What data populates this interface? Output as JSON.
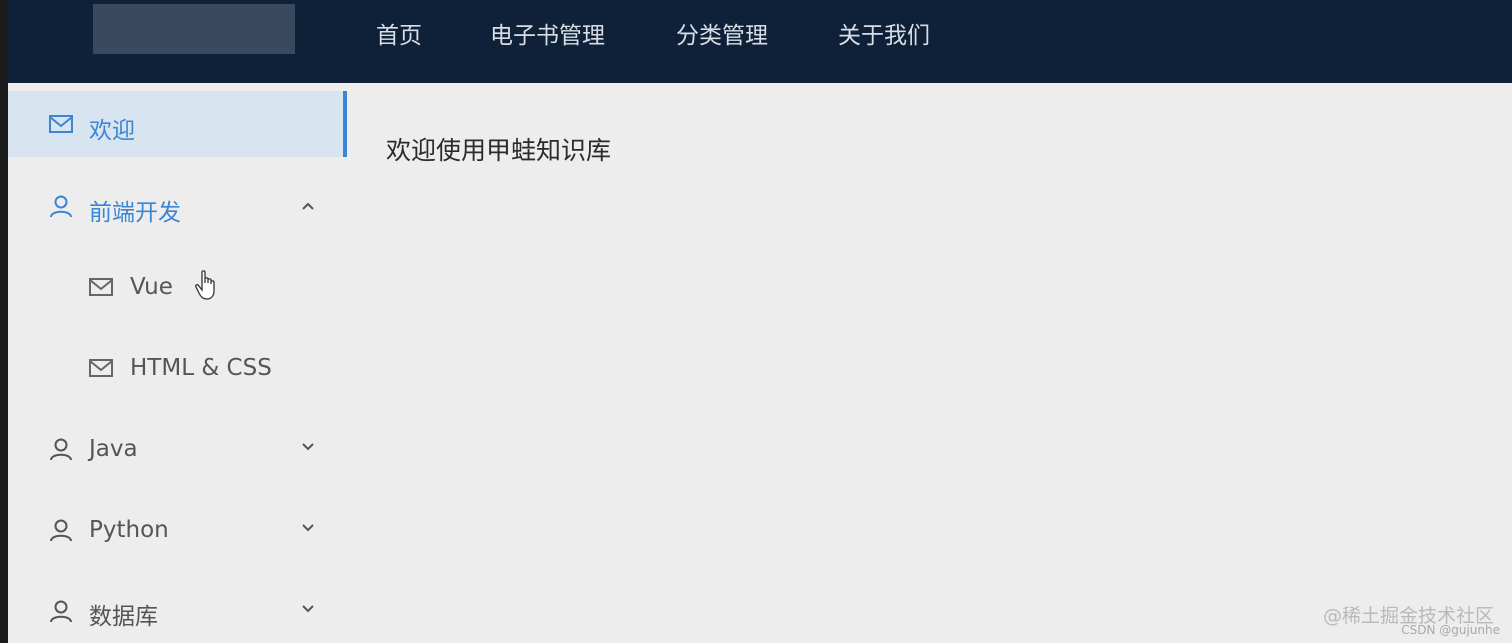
{
  "header": {
    "nav_items": [
      "首页",
      "电子书管理",
      "分类管理",
      "关于我们"
    ]
  },
  "sidebar": {
    "items": [
      {
        "label": "欢迎",
        "icon": "mail-icon",
        "active": true
      },
      {
        "label": "前端开发",
        "icon": "user-icon",
        "expanded": true,
        "chevron": "chevron-up-icon"
      },
      {
        "label": "Vue",
        "icon": "mail-icon",
        "sub": true
      },
      {
        "label": "HTML & CSS",
        "icon": "mail-icon",
        "sub": true
      },
      {
        "label": "Java",
        "icon": "user-icon",
        "chevron": "chevron-down-icon"
      },
      {
        "label": "Python",
        "icon": "user-icon",
        "chevron": "chevron-down-icon"
      },
      {
        "label": "数据库",
        "icon": "user-icon",
        "chevron": "chevron-down-icon"
      }
    ]
  },
  "main": {
    "title": "欢迎使用甲蛙知识库"
  },
  "watermark": {
    "line1": "@稀土掘金技术社区",
    "line2": "CSDN @gujunhe"
  },
  "colors": {
    "header_bg": "#0f2138",
    "accent": "#3a86d4",
    "content_bg": "#ededed"
  }
}
